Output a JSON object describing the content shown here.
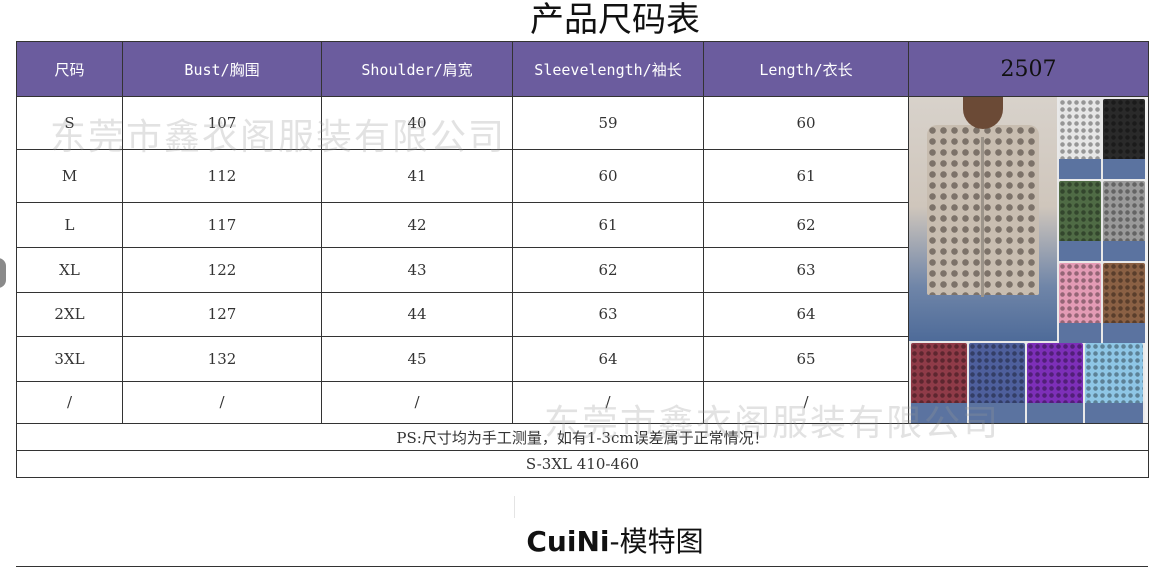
{
  "page": {
    "title": "产品尺码表"
  },
  "table": {
    "headers": [
      "尺码",
      "Bust/胸围",
      "Shoulder/肩宽",
      "Sleevelength/袖长",
      "Length/衣长"
    ],
    "product_code": "2507",
    "rows": [
      [
        "S",
        "107",
        "40",
        "59",
        "60"
      ],
      [
        "M",
        "112",
        "41",
        "60",
        "61"
      ],
      [
        "L",
        "117",
        "42",
        "61",
        "62"
      ],
      [
        "XL",
        "122",
        "43",
        "62",
        "63"
      ],
      [
        "2XL",
        "127",
        "44",
        "63",
        "64"
      ],
      [
        "3XL",
        "132",
        "45",
        "64",
        "65"
      ],
      [
        "/",
        "/",
        "/",
        "/",
        "/"
      ]
    ],
    "note": "PS:尺寸均为手工测量，如有1-3cm误差属于正常情况！",
    "range": "S-3XL   410-460"
  },
  "watermark": {
    "text": "东莞市鑫衣阁服装有限公司"
  },
  "footer": {
    "brand": "CuiNi",
    "suffix": "-模特图"
  },
  "colors": {
    "header_bg": "#6b5c9e",
    "note_text": "#e0202a",
    "thumb_swatches": [
      "#e6e6e6",
      "#2a2a2a",
      "#4f6b45",
      "#9a9a9a",
      "#e39bb5",
      "#8a6044",
      "#8f3b48",
      "#4e5f9c",
      "#7d2fb8",
      "#8ec6e6"
    ]
  }
}
